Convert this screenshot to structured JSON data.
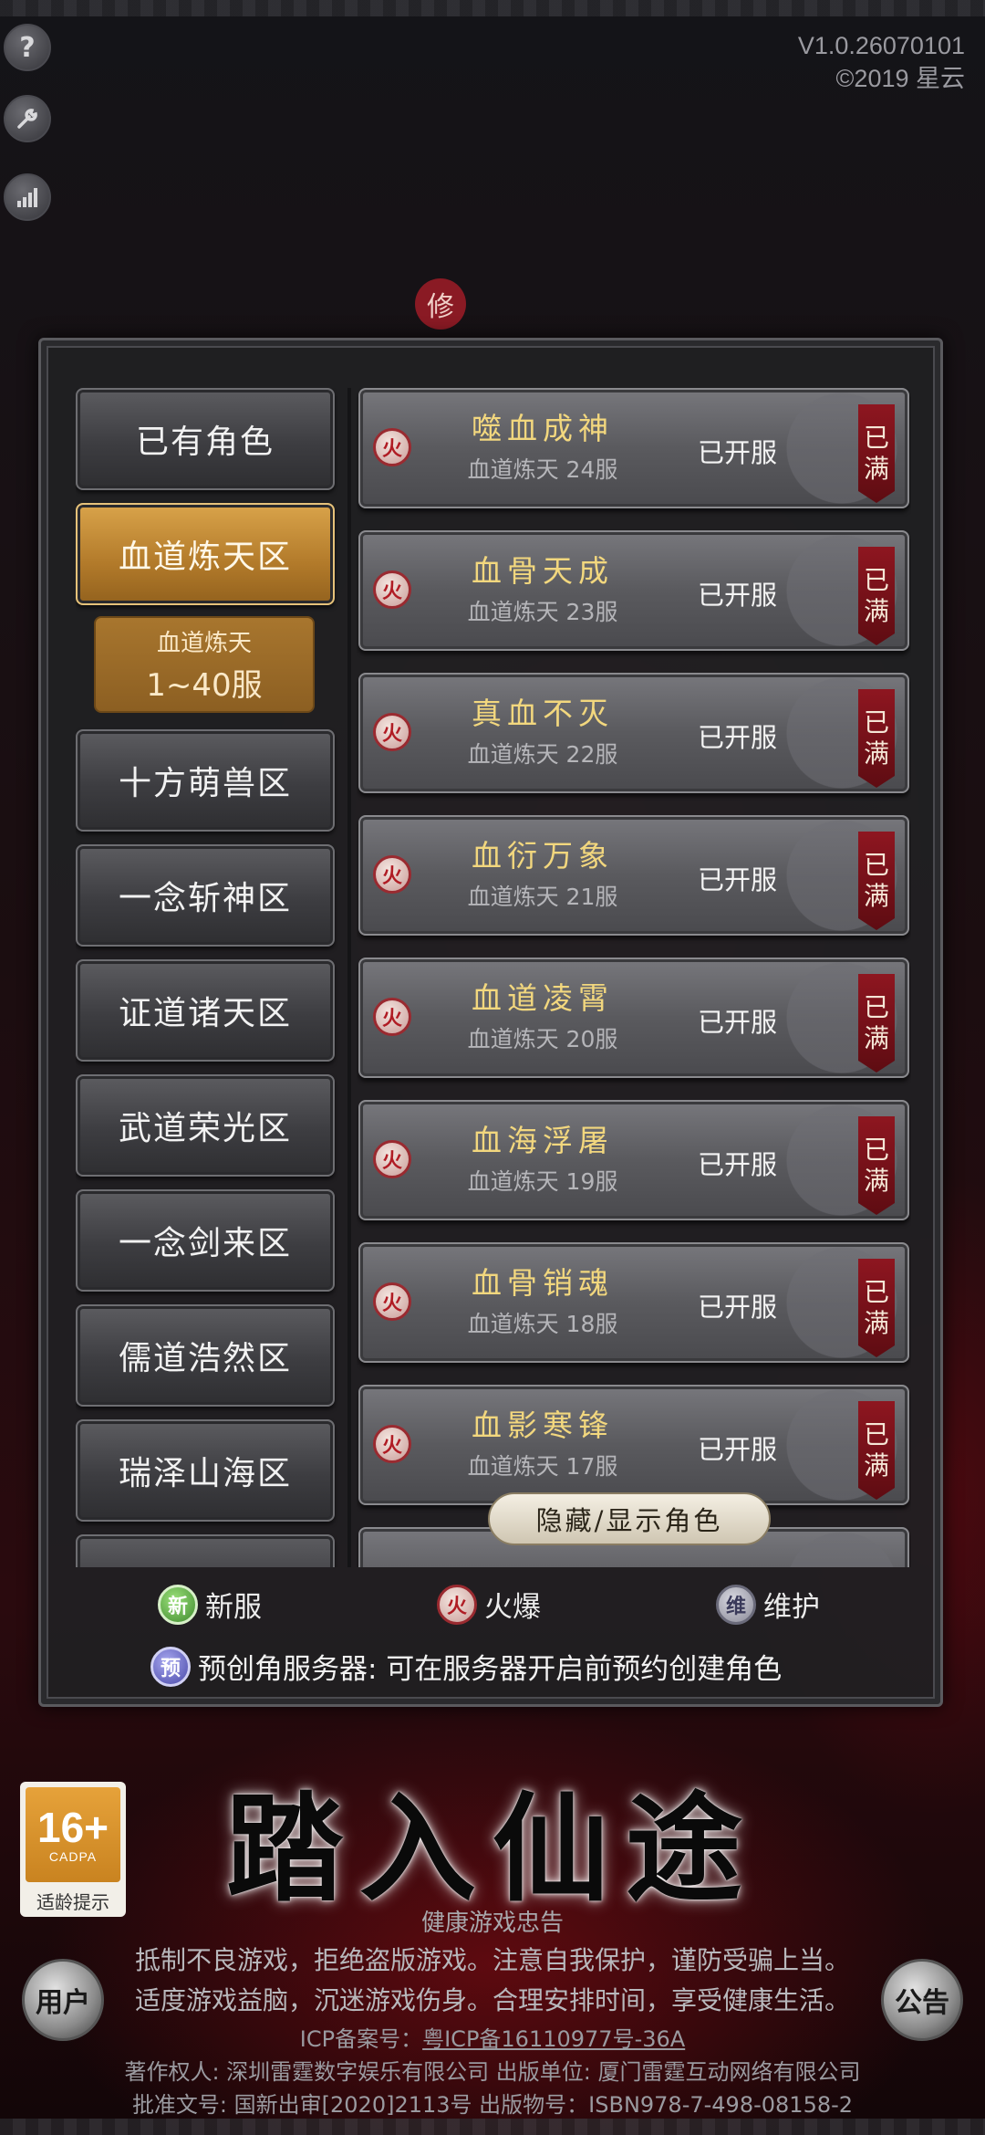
{
  "version": {
    "line1": "V1.0.26070101",
    "line2": "©2019 星云"
  },
  "top_icons": {
    "help": "?",
    "settings_icon": "wrench-icon",
    "network_icon": "signal-bars-icon"
  },
  "title_seal": "修",
  "left_menu": {
    "existing": "已有角色",
    "active_zone": "血道炼天区",
    "sub_range_line1": "血道炼天",
    "sub_range_line2": "1~40服",
    "zones": [
      "十方萌兽区",
      "一念斩神区",
      "证道诸天区",
      "武道荣光区",
      "一念剑来区",
      "儒道浩然区",
      "瑞泽山海区"
    ]
  },
  "servers": [
    {
      "icon": "火",
      "name": "噬血成神",
      "sub": "血道炼天 24服",
      "status": "已开服",
      "tag1": "已",
      "tag2": "满"
    },
    {
      "icon": "火",
      "name": "血骨天成",
      "sub": "血道炼天 23服",
      "status": "已开服",
      "tag1": "已",
      "tag2": "满"
    },
    {
      "icon": "火",
      "name": "真血不灭",
      "sub": "血道炼天 22服",
      "status": "已开服",
      "tag1": "已",
      "tag2": "满"
    },
    {
      "icon": "火",
      "name": "血衍万象",
      "sub": "血道炼天 21服",
      "status": "已开服",
      "tag1": "已",
      "tag2": "满"
    },
    {
      "icon": "火",
      "name": "血道凌霄",
      "sub": "血道炼天 20服",
      "status": "已开服",
      "tag1": "已",
      "tag2": "满"
    },
    {
      "icon": "火",
      "name": "血海浮屠",
      "sub": "血道炼天 19服",
      "status": "已开服",
      "tag1": "已",
      "tag2": "满"
    },
    {
      "icon": "火",
      "name": "血骨销魂",
      "sub": "血道炼天 18服",
      "status": "已开服",
      "tag1": "已",
      "tag2": "满"
    },
    {
      "icon": "火",
      "name": "血影寒锋",
      "sub": "血道炼天 17服",
      "status": "已开服",
      "tag1": "已",
      "tag2": "满"
    }
  ],
  "toggle_label": "隐藏/显示角色",
  "legend": {
    "new_icon": "新",
    "new_label": "新服",
    "hot_icon": "火",
    "hot_label": "火爆",
    "maint_icon": "维",
    "maint_label": "维护",
    "pre_icon": "预",
    "pre_label": "预创角服务器: 可在服务器开启前预约创建角色"
  },
  "age_badge": {
    "age": "16+",
    "org": "CADPA",
    "tip": "适龄提示"
  },
  "start_label": "踏入仙途",
  "corner_left": "用户",
  "corner_right": "公告",
  "notice": {
    "title": "健康游戏忠告",
    "line1": "抵制不良游戏，拒绝盗版游戏。注意自我保护，谨防受骗上当。",
    "line2": "适度游戏益脑，沉迷游戏伤身。合理安排时间，享受健康生活。",
    "icp_label": "ICP备案号：",
    "icp_value": "粤ICP备16110977号-36A",
    "copyright": "著作权人: 深圳雷霆数字娱乐有限公司 出版单位: 厦门雷霆互动网络有限公司",
    "isbn": "批准文号: 国新出审[2020]2113号 出版物号：ISBN978-7-498-08158-2"
  },
  "colors": {
    "accent_gold": "#f2d77e",
    "active_zone": "#c18a34",
    "full_tag": "#8e1620"
  }
}
